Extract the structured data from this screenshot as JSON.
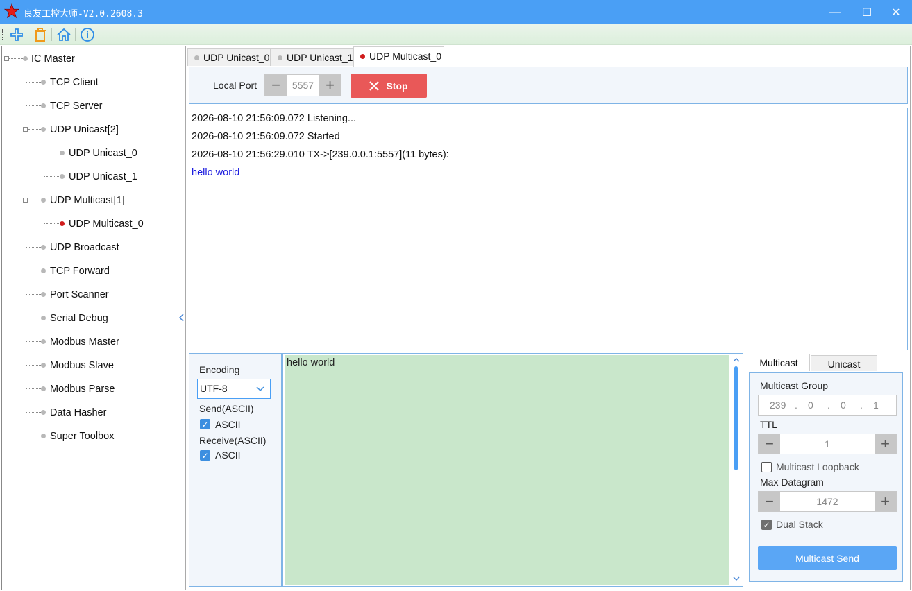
{
  "window": {
    "title": "良友工控大师-V2.0.2608.3",
    "minimize_glyph": "—",
    "maximize_glyph": "☐",
    "close_glyph": "✕"
  },
  "toolbar": {
    "icons": [
      "add-icon",
      "delete-icon",
      "home-icon",
      "info-icon"
    ]
  },
  "tree": {
    "root": "IC Master",
    "items": {
      "tcp_client": "TCP Client",
      "tcp_server": "TCP Server",
      "udp_unicast": "UDP Unicast[2]",
      "udp_unicast_0": "UDP Unicast_0",
      "udp_unicast_1": "UDP Unicast_1",
      "udp_multicast": "UDP Multicast[1]",
      "udp_multicast_0": "UDP Multicast_0",
      "udp_broadcast": "UDP Broadcast",
      "tcp_forward": "TCP Forward",
      "port_scanner": "Port Scanner",
      "serial_debug": "Serial Debug",
      "modbus_master": "Modbus Master",
      "modbus_slave": "Modbus Slave",
      "modbus_parse": "Modbus Parse",
      "data_hasher": "Data Hasher",
      "super_toolbox": "Super Toolbox"
    }
  },
  "tabs": [
    "UDP Unicast_0",
    "UDP Unicast_1",
    "UDP Multicast_0"
  ],
  "port_panel": {
    "label": "Local Port",
    "value": "5557",
    "stop_label": "Stop"
  },
  "log": {
    "lines": [
      "2026-08-10 21:56:09.072 Listening...",
      "2026-08-10 21:56:09.072 Started",
      "2026-08-10 21:56:29.010 TX->[239.0.0.1:5557](11 bytes):",
      "hello world"
    ]
  },
  "encoding": {
    "label": "Encoding",
    "value": "UTF-8",
    "send_label": "Send(ASCII)",
    "send_ascii": "ASCII",
    "receive_label": "Receive(ASCII)",
    "receive_ascii": "ASCII"
  },
  "send_text": "hello world",
  "right_tabs": [
    "Multicast",
    "Unicast"
  ],
  "multicast": {
    "group_label": "Multicast Group",
    "ip": [
      "239",
      "0",
      "0",
      "1"
    ],
    "ttl_label": "TTL",
    "ttl_value": "1",
    "loopback_label": "Multicast Loopback",
    "max_datagram_label": "Max Datagram",
    "max_datagram_value": "1472",
    "dual_stack_label": "Dual Stack",
    "send_label": "Multicast Send"
  },
  "colors": {
    "titlebar": "#4a9ff5",
    "stop_button": "#e95858",
    "send_button": "#5aa6f5",
    "send_area": "#c9e7cb",
    "active_dot": "#d01c1c"
  }
}
